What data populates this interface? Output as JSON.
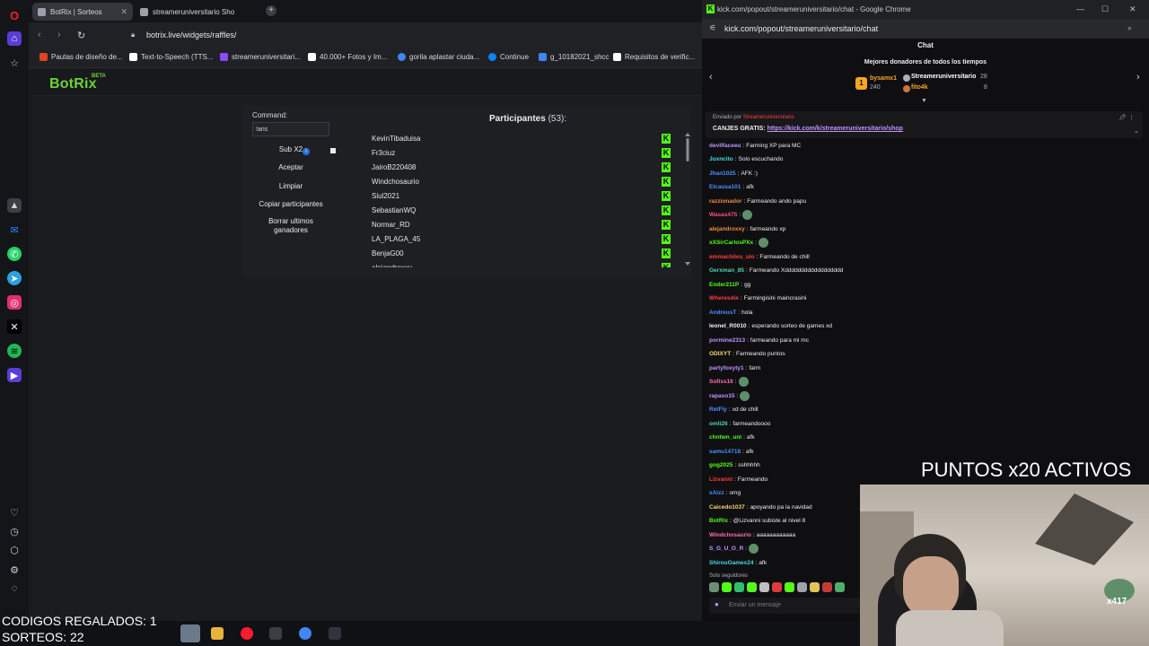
{
  "opera": {
    "tabs": [
      {
        "label": "BotRix | Sorteos",
        "active": true
      },
      {
        "label": "streameruniversitario Sho",
        "active": false
      }
    ],
    "url": "botrix.live/widgets/raffles/",
    "bookmarks": [
      {
        "label": "Pautas de diseño de...",
        "color": "#e0451f"
      },
      {
        "label": "Text-to-Speech (TTS...",
        "color": "#ffffff"
      },
      {
        "label": "streameruniversitari...",
        "color": "#9146ff"
      },
      {
        "label": "40.000+ Fotos y Im...",
        "color": "#ffffff"
      },
      {
        "label": "gorila aplastar ciuda...",
        "color": "#4285f4"
      },
      {
        "label": "Continue",
        "color": "#0a84ff"
      },
      {
        "label": "g_10182021_shcc",
        "color": "#4285f4"
      },
      {
        "label": "Requisitos de verific...",
        "color": "#ffffff"
      }
    ]
  },
  "botrix": {
    "logo": "BotRix",
    "logo_beta": "BETA",
    "command_label": "Command:",
    "command_value": "!aris",
    "sub_label": "Sub X2",
    "accept": "Aceptar",
    "clear": "Limpiar",
    "copy": "Copiar participantes",
    "delete_winners": "Borrar ultimos ganadores",
    "participants_title": "Participantes",
    "participants_count": "(53):",
    "participants": [
      "KevinTibaduisa",
      "Fr3ciuz",
      "JairoB220408",
      "Windchosaurio",
      "Siul2021",
      "SebastianWQ",
      "Normar_RD",
      "LA_PLAGA_45",
      "BenjaG00",
      "alejandroxxy"
    ],
    "k_glyph": "K"
  },
  "chrome": {
    "window_title": "kick.com/popout/streameruniversitario/chat - Google Chrome",
    "url": "kick.com/popout/streameruniversitario/chat"
  },
  "chat": {
    "title": "Chat",
    "donors_title": "Mejores donadores de todos los tiempos",
    "donors": [
      {
        "name": "bysamx1",
        "amount": "240",
        "color": "#f5a623"
      },
      {
        "name": "Streameruniversitario",
        "amount": "28",
        "color": "#efeff1"
      },
      {
        "name": "fito4k",
        "amount": "8",
        "color": "#f5a623"
      }
    ],
    "pinned_from": "Enviado por",
    "pinned_user": "Streameruniversitario",
    "pinned_text": "CANJES GRATIS:",
    "pinned_link": "https://kick.com/k/streameruniversitario/shop",
    "messages": [
      {
        "user": "devilfaceeu",
        "color": "#bf94ff",
        "text": "Farming XP para MC"
      },
      {
        "user": "Juxncito",
        "color": "#4ad7e8",
        "text": "Solo escuchando"
      },
      {
        "user": "Jhan1025",
        "color": "#4a90ff",
        "text": "AFK :)"
      },
      {
        "user": "Elcausa101",
        "color": "#4a90ff",
        "text": "afk"
      },
      {
        "user": "razzionador",
        "color": "#f28c38",
        "text": "Farmeando ando papu"
      },
      {
        "user": "Wasas475",
        "color": "#ff4f7b",
        "text": ""
      },
      {
        "user": "alejandroxxy",
        "color": "#f28c38",
        "text": "farmeando xp"
      },
      {
        "user": "xXSirCarlosPXx",
        "color": "#53fc18",
        "text": ""
      },
      {
        "user": "emmachiles_uio",
        "color": "#ff3d3d",
        "text": "Farmeando de chill"
      },
      {
        "user": "Gerxman_85",
        "color": "#4ad7b0",
        "text": "Farmeando Xdddddddddddddddddd"
      },
      {
        "user": "Ender211P",
        "color": "#53fc18",
        "text": "gg"
      },
      {
        "user": "Wheresdie",
        "color": "#ff3d3d",
        "text": "Farmingisini maincrasini"
      },
      {
        "user": "AndreusT",
        "color": "#4a90ff",
        "text": "hola"
      },
      {
        "user": "leonel_R0010",
        "color": "#efeff1",
        "text": "esperando sorteo de games xd"
      },
      {
        "user": "pormine2313",
        "color": "#bf94ff",
        "text": "farmeando para mi mc"
      },
      {
        "user": "ODIXYT",
        "color": "#f5d76e",
        "text": "Farmeando puntos"
      },
      {
        "user": "partyfoxyty1",
        "color": "#bf94ff",
        "text": "farm"
      },
      {
        "user": "Sofiss16",
        "color": "#ff6fae",
        "text": ""
      },
      {
        "user": "rapaso15",
        "color": "#bf94ff",
        "text": ""
      },
      {
        "user": "RetFly",
        "color": "#4a90ff",
        "text": "xd de chill"
      },
      {
        "user": "omli26",
        "color": "#4ad7b0",
        "text": "farmeandoooo"
      },
      {
        "user": "chntwn_uni",
        "color": "#53fc18",
        "text": "afk"
      },
      {
        "user": "samu14718",
        "color": "#4a90ff",
        "text": "afk"
      },
      {
        "user": "gog2025",
        "color": "#53fc18",
        "text": "sshhhhh"
      },
      {
        "user": "Lizvanni",
        "color": "#ff3d3d",
        "text": "Farmeando"
      },
      {
        "user": "xAizz",
        "color": "#4a90ff",
        "text": "omg"
      },
      {
        "user": "Caicedo1037",
        "color": "#f5d76e",
        "text": "apoyando pa la navidad"
      },
      {
        "user": "BotRix",
        "color": "#53fc18",
        "text": "@Lizvanni subiste al nivel 8"
      },
      {
        "user": "Windchosaurio",
        "color": "#ff6fae",
        "text": "aaaaaaaaaaaa"
      },
      {
        "user": "S_G_U_O_R",
        "color": "#bf94ff",
        "text": ""
      },
      {
        "user": "ShirouGamex24",
        "color": "#4ad7e8",
        "text": "afk"
      }
    ],
    "followers_only": "Solo seguidores",
    "input_placeholder": "Enviar un mensaje"
  },
  "overlay": {
    "points_banner": "PUNTOS x20 ACTIVOS",
    "codes": "CODIGOS REGALADOS: 1",
    "raffles": "SORTEOS: 22",
    "cam_tag": "x417"
  }
}
